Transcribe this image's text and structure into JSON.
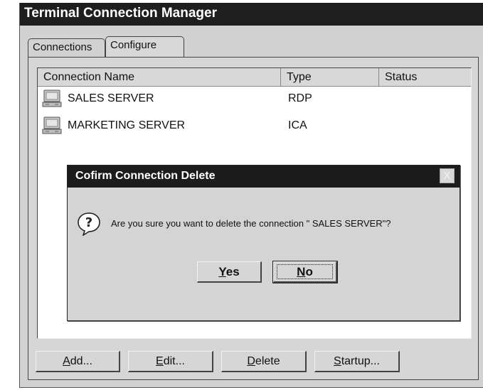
{
  "window": {
    "title": "Terminal Connection Manager"
  },
  "tabs": [
    {
      "label": "Connections",
      "active": false
    },
    {
      "label": "Configure",
      "active": true
    }
  ],
  "list": {
    "columns": [
      "Connection Name",
      "Type",
      "Status"
    ],
    "rows": [
      {
        "name": "SALES SERVER",
        "type": "RDP",
        "status": "",
        "icon": "computer-icon"
      },
      {
        "name": "MARKETING SERVER",
        "type": "ICA",
        "status": "",
        "icon": "computer-icon"
      }
    ]
  },
  "dialog": {
    "title": "Cofirm Connection Delete",
    "close_label": "X",
    "icon": "question-icon",
    "message": "Are you sure you want to delete the connection \" SALES SERVER\"?",
    "yes": {
      "mnemonic": "Y",
      "rest": "es"
    },
    "no": {
      "mnemonic": "N",
      "rest": "o"
    }
  },
  "buttons": {
    "add": {
      "mnemonic": "A",
      "rest": "dd..."
    },
    "edit": {
      "mnemonic": "E",
      "rest": "dit..."
    },
    "delete": {
      "mnemonic": "D",
      "rest": "elete"
    },
    "startup": {
      "mnemonic": "S",
      "rest": "tartup..."
    }
  },
  "colors": {
    "titlebar": "#1e1e1e",
    "window_bg": "#d2d2d2",
    "list_bg": "#ffffff"
  }
}
